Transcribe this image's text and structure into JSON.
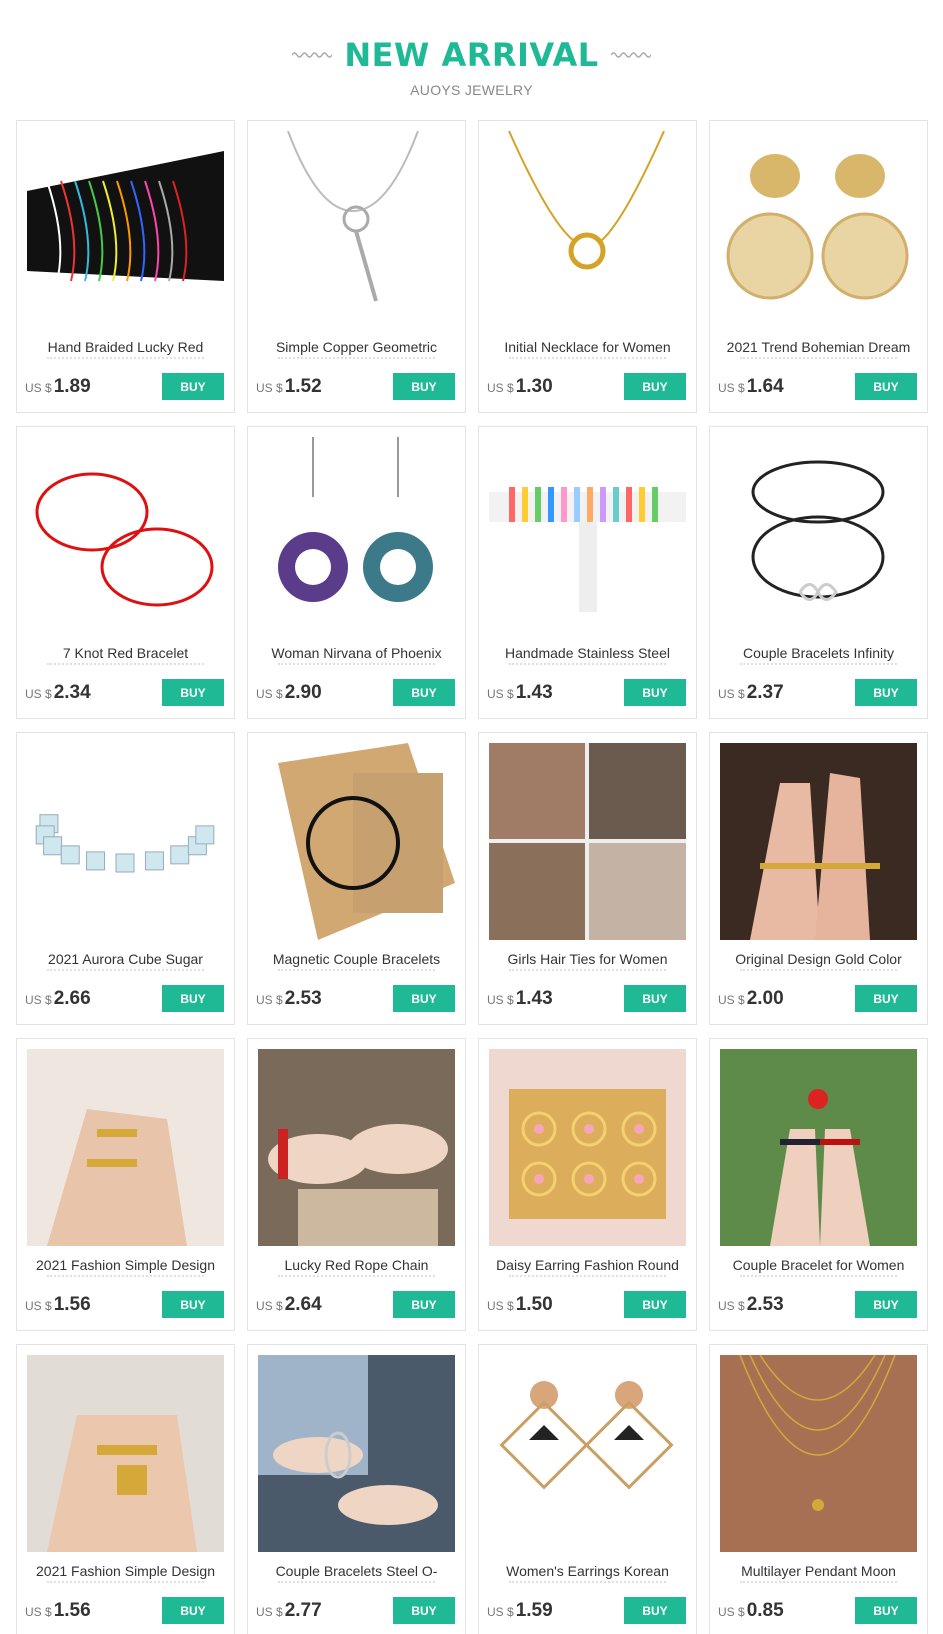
{
  "header": {
    "title": "NEW ARRIVAL",
    "subtitle": "AUOYS JEWELRY"
  },
  "colors": {
    "accent": "#1fb996"
  },
  "currency": "US $",
  "buy_label": "BUY",
  "products": [
    {
      "name": "Hand Braided Lucky Red",
      "price": "1.89",
      "icon": "bracelet-display-icon"
    },
    {
      "name": "Simple Copper Geometric",
      "price": "1.52",
      "icon": "lariat-necklace-icon"
    },
    {
      "name": "Initial Necklace for Women",
      "price": "1.30",
      "icon": "circle-necklace-icon"
    },
    {
      "name": "2021 Trend Bohemian Dream",
      "price": "1.64",
      "icon": "disc-earrings-icon"
    },
    {
      "name": "7 Knot Red Bracelet",
      "price": "2.34",
      "icon": "red-string-bracelet-icon"
    },
    {
      "name": "Woman Nirvana of Phoenix",
      "price": "2.90",
      "icon": "crystal-earrings-icon"
    },
    {
      "name": "Handmade Stainless Steel",
      "price": "1.43",
      "icon": "bracelet-stand-icon"
    },
    {
      "name": "Couple Bracelets Infinity",
      "price": "2.37",
      "icon": "infinity-bracelet-icon"
    },
    {
      "name": "2021 Aurora Cube Sugar",
      "price": "2.66",
      "icon": "cube-bracelet-icon"
    },
    {
      "name": "Magnetic Couple Bracelets",
      "price": "2.53",
      "icon": "magnetic-bracelet-card-icon"
    },
    {
      "name": "Girls Hair Ties for Women",
      "price": "1.43",
      "icon": "hair-ties-photo-icon"
    },
    {
      "name": "Original Design Gold Color",
      "price": "2.00",
      "icon": "gold-rings-hand-icon"
    },
    {
      "name": "2021 Fashion Simple Design",
      "price": "1.56",
      "icon": "rings-hand-icon"
    },
    {
      "name": "Lucky Red Rope Chain",
      "price": "2.64",
      "icon": "rope-bracelet-photo-icon"
    },
    {
      "name": "Daisy Earring Fashion Round",
      "price": "1.50",
      "icon": "daisy-earrings-tray-icon"
    },
    {
      "name": "Couple Bracelet for Women",
      "price": "2.53",
      "icon": "couple-hands-bracelet-icon"
    },
    {
      "name": "2021 Fashion Simple Design",
      "price": "1.56",
      "icon": "chain-rings-hand-icon"
    },
    {
      "name": "Couple Bracelets Steel O-",
      "price": "2.77",
      "icon": "steel-bracelet-photo-icon"
    },
    {
      "name": "Women's Earrings Korean",
      "price": "1.59",
      "icon": "square-drop-earrings-icon"
    },
    {
      "name": "Multilayer Pendant Moon",
      "price": "0.85",
      "icon": "layered-necklace-icon"
    }
  ]
}
